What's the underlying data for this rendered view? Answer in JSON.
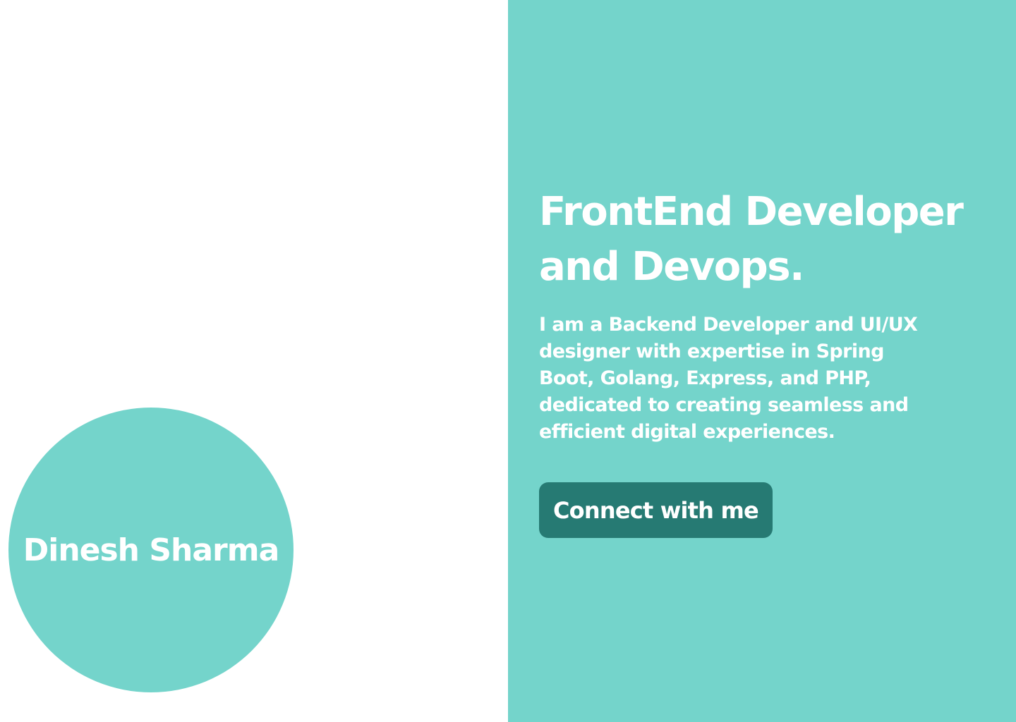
{
  "colors": {
    "accent": "#74D4CB",
    "button": "#267A73",
    "text_on_accent": "#FFFFFF",
    "background": "#FFFFFF"
  },
  "profile": {
    "name": "Dinesh Sharma"
  },
  "hero": {
    "headline": "FrontEnd Developer and Devops.",
    "bio": "I am a Backend Developer and UI/UX designer with expertise in Spring Boot, Golang, Express, and PHP, dedicated to creating seamless and efficient digital experiences.",
    "cta_label": "Connect with me"
  }
}
